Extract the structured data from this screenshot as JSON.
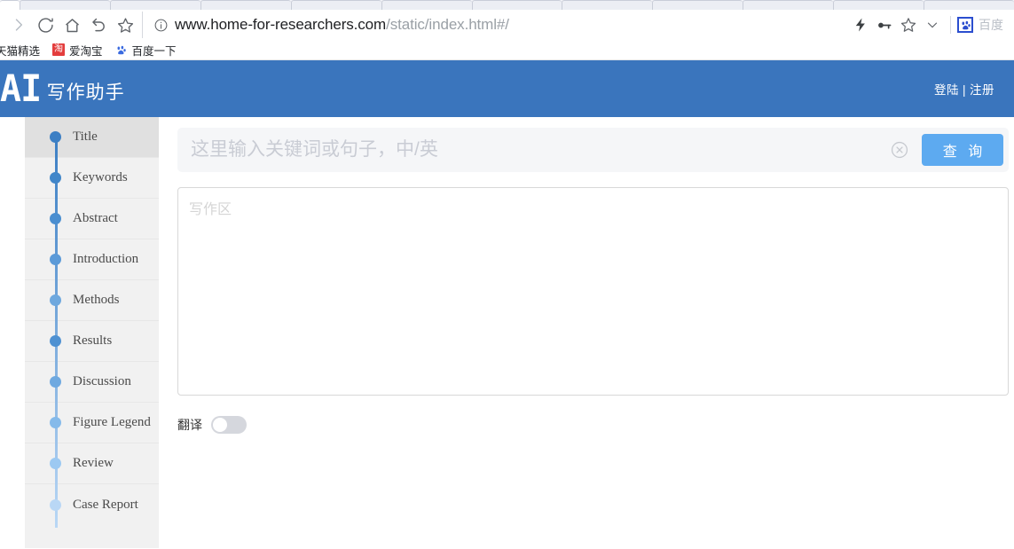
{
  "browser": {
    "nav_icons": [
      "forward-icon",
      "reload-icon",
      "home-icon",
      "back-arrow-icon",
      "bookmark-star-icon"
    ],
    "url_main": "www.home-for-researchers.com",
    "url_path": "/static/index.html#/",
    "site_info_icon": "site-info-icon",
    "right_icons": [
      "lightning-icon",
      "key-icon",
      "star-icon",
      "chevron-down-icon"
    ],
    "extension_label": "百度",
    "bookmarks": [
      {
        "label": "天猫精选",
        "icon": ""
      },
      {
        "label": "爱淘宝",
        "icon": "淘"
      },
      {
        "label": "百度一下",
        "icon": "paw"
      }
    ],
    "tab_count": 11
  },
  "header": {
    "logo_main": "AI",
    "logo_sub": "写作助手",
    "login_label": "登陆",
    "separator": "|",
    "register_label": "注册",
    "background_color": "#3a75bd"
  },
  "sidebar": {
    "items": [
      {
        "label": "Title",
        "dot_color": "#3c7fc4",
        "active": true
      },
      {
        "label": "Keywords",
        "dot_color": "#4186c9",
        "active": false
      },
      {
        "label": "Abstract",
        "dot_color": "#4a8ed0",
        "active": false
      },
      {
        "label": "Introduction",
        "dot_color": "#5b9ad8",
        "active": false
      },
      {
        "label": "Methods",
        "dot_color": "#6ea8de",
        "active": false
      },
      {
        "label": "Results",
        "dot_color": "#4e91d2",
        "active": false
      },
      {
        "label": "Discussion",
        "dot_color": "#6fa9e0",
        "active": false
      },
      {
        "label": "Figure Legend",
        "dot_color": "#85baea",
        "active": false
      },
      {
        "label": "Review",
        "dot_color": "#9cc9f2",
        "active": false
      },
      {
        "label": "Case Report",
        "dot_color": "#b9d7f5",
        "active": false
      }
    ]
  },
  "main": {
    "search": {
      "placeholder": "这里输入关键词或句子，中/英",
      "value": "",
      "clear_icon": "clear-circle-icon",
      "button_label": "查 询",
      "button_color": "#5daaf0"
    },
    "editor": {
      "placeholder": "写作区",
      "value": ""
    },
    "translate": {
      "label": "翻译",
      "enabled": false
    }
  }
}
